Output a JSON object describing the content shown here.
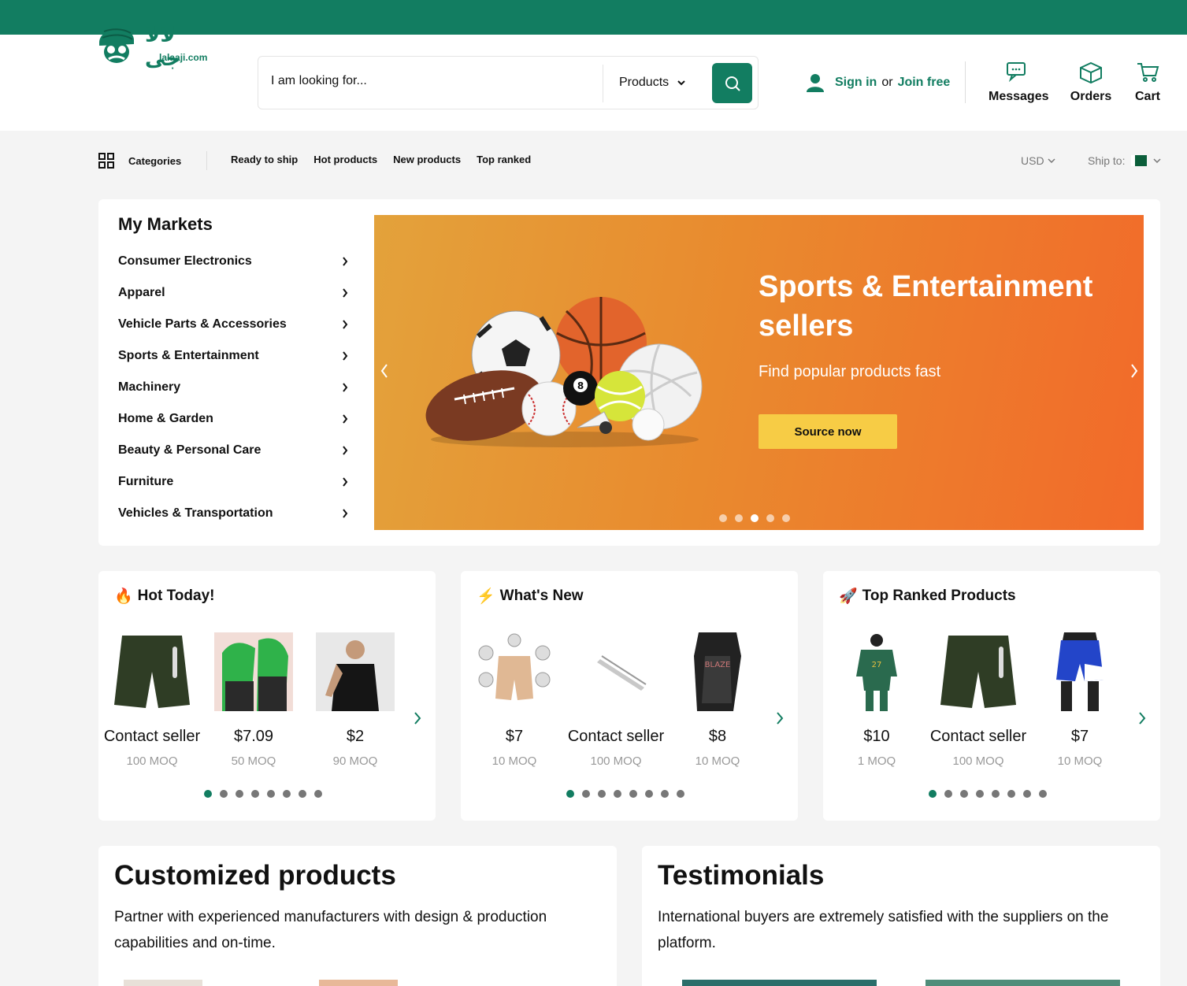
{
  "brand": {
    "arabic": "لالا جی",
    "domain": "lalaaji.com",
    "color": "#127d61"
  },
  "search": {
    "placeholder": "I am looking for...",
    "type": "Products"
  },
  "account": {
    "sign_in": "Sign in",
    "or": "or",
    "join": "Join free"
  },
  "header_actions": [
    {
      "label": "Messages",
      "icon": "messages-icon"
    },
    {
      "label": "Orders",
      "icon": "orders-icon"
    },
    {
      "label": "Cart",
      "icon": "cart-icon"
    }
  ],
  "subnav": {
    "categories": "Categories",
    "links": [
      "Ready to ship",
      "Hot products",
      "New products",
      "Top ranked"
    ],
    "currency": "USD",
    "ship_to": "Ship to:"
  },
  "markets": {
    "title": "My Markets",
    "items": [
      "Consumer Electronics",
      "Apparel",
      "Vehicle Parts & Accessories",
      "Sports & Entertainment",
      "Machinery",
      "Home & Garden",
      "Beauty & Personal Care",
      "Furniture",
      "Vehicles & Transportation"
    ]
  },
  "banner": {
    "title": "Sports & Entertainment sellers",
    "subtitle": "Find popular products fast",
    "cta": "Source now",
    "slide_count": 5,
    "active_slide": 3
  },
  "cards": [
    {
      "emoji": "🔥",
      "title": "Hot Today!",
      "products": [
        {
          "price": "Contact seller",
          "moq": "100 MOQ"
        },
        {
          "price": "$7.09",
          "moq": "50 MOQ"
        },
        {
          "price": "$2",
          "moq": "90 MOQ"
        }
      ]
    },
    {
      "emoji": "⚡",
      "title": "What's New",
      "products": [
        {
          "price": "$7",
          "moq": "10 MOQ"
        },
        {
          "price": "Contact seller",
          "moq": "100 MOQ"
        },
        {
          "price": "$8",
          "moq": "10 MOQ"
        }
      ]
    },
    {
      "emoji": "🚀",
      "title": "Top Ranked Products",
      "products": [
        {
          "price": "$10",
          "moq": "1 MOQ"
        },
        {
          "price": "Contact seller",
          "moq": "100 MOQ"
        },
        {
          "price": "$7",
          "moq": "10 MOQ"
        }
      ]
    }
  ],
  "customized": {
    "title": "Customized products",
    "text": "Partner with experienced manufacturers with design & production capabilities and on-time."
  },
  "testimonials": {
    "title": "Testimonials",
    "text": "International buyers are extremely satisfied with the suppliers on the platform."
  }
}
